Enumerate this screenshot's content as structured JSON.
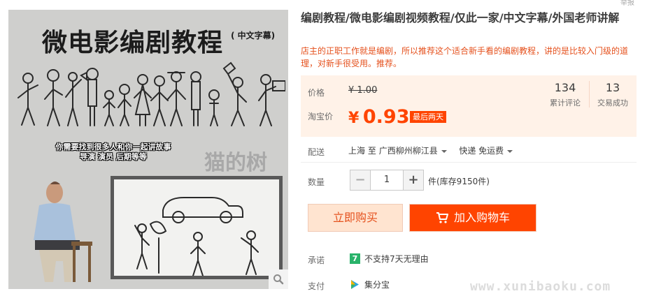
{
  "gallery": {
    "hero_title": "微电影编剧教程",
    "hero_subtitle": "( 中文字幕)",
    "caption_line1": "你需要找到很多人和你一起讲故事",
    "caption_line2": "导演 演员 后期等等",
    "watermark": "猫的树",
    "zoom_icon": "magnifier-icon"
  },
  "corner_tip": "举报",
  "product": {
    "title": "编剧教程/微电影编剧视频教程/仅此一家/中文字幕/外国老师讲解",
    "description": "店主的正职工作就是编剧，所以推荐这个适合新手看的编剧教程，讲的是比较入门级的道理，对新手很受用。推荐。"
  },
  "price": {
    "label": "价格",
    "original": "¥ 1.00",
    "promo_label": "淘宝价",
    "currency": "¥",
    "promo_value": "0.93",
    "promo_tag": "最后两天"
  },
  "stats": [
    {
      "count": "134",
      "label": "累计评论"
    },
    {
      "count": "13",
      "label": "交易成功"
    }
  ],
  "shipping": {
    "label": "配送",
    "from": "上海",
    "to_word": "至",
    "destination": "广西柳州柳江县",
    "method": "快递 免运费"
  },
  "quantity": {
    "label": "数量",
    "minus": "−",
    "value": "1",
    "plus": "+",
    "unit": "件(库存9150件)"
  },
  "actions": {
    "buy_now": "立即购买",
    "add_cart": "加入购物车"
  },
  "services": {
    "promise_label": "承诺",
    "promise_badge": "7",
    "promise_text": "不支持7天无理由",
    "pay_label": "支付",
    "pay_text": "集分宝"
  },
  "site_watermark": "www.xunibaoku.com",
  "colors": {
    "accent": "#ff4400",
    "price_bg": "#fff2e8",
    "buy_now_bg": "#ffe4d0",
    "promise_green": "#29b36a"
  }
}
